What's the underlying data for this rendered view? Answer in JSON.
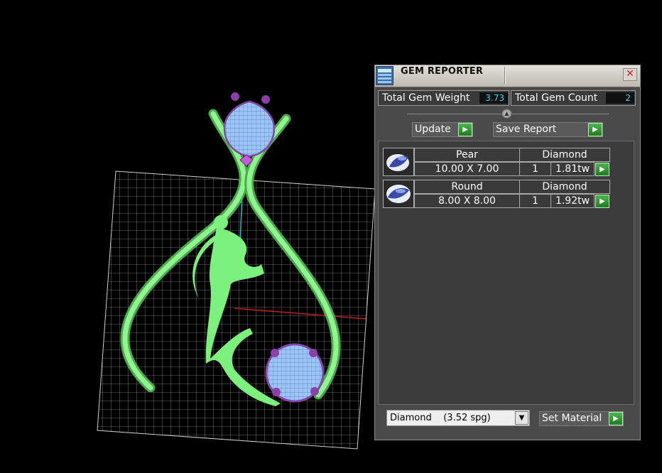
{
  "panel": {
    "title": "GEM REPORTER",
    "close_glyph": "✕",
    "total_gem_weight_label": "Total Gem Weight",
    "total_gem_weight_value": "3.73",
    "total_gem_count_label": "Total Gem Count",
    "total_gem_count_value": "2",
    "update_label": "Update",
    "save_report_label": "Save Report",
    "play_glyph": "▶",
    "gems": [
      {
        "shape": "Pear",
        "material": "Diamond",
        "size": "10.00 X 7.00",
        "qty": "1",
        "weight": "1.81tw",
        "thumb_icon": "pear-gem-icon"
      },
      {
        "shape": "Round",
        "material": "Diamond",
        "size": "8.00 X 8.00",
        "qty": "1",
        "weight": "1.92tw",
        "thumb_icon": "round-gem-icon"
      }
    ],
    "material_select_value": "Diamond    (3.52 spg)",
    "dropdown_glyph": "▼",
    "set_material_label": "Set Material"
  },
  "colors": {
    "model_green": "#7cf07c",
    "gem_blue": "#9ec3f5",
    "prong_purple": "#8b3fa8",
    "accent_cyan": "#3ad0e8"
  }
}
